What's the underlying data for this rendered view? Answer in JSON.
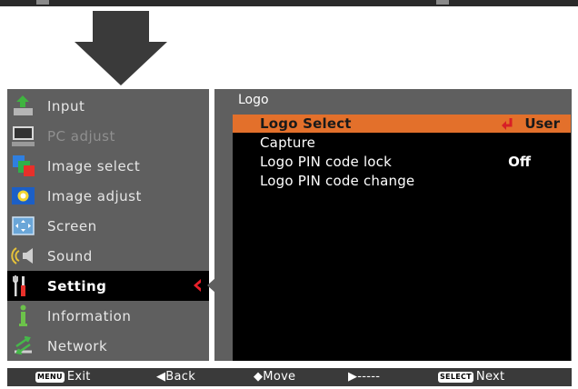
{
  "menu": {
    "items": [
      {
        "label": "Input",
        "icon": "input-icon",
        "state": "normal"
      },
      {
        "label": "PC adjust",
        "icon": "pc-adjust-icon",
        "state": "disabled"
      },
      {
        "label": "Image select",
        "icon": "image-select-icon",
        "state": "normal"
      },
      {
        "label": "Image adjust",
        "icon": "image-adjust-icon",
        "state": "normal"
      },
      {
        "label": "Screen",
        "icon": "screen-icon",
        "state": "normal"
      },
      {
        "label": "Sound",
        "icon": "sound-icon",
        "state": "normal"
      },
      {
        "label": "Setting",
        "icon": "setting-icon",
        "state": "selected"
      },
      {
        "label": "Information",
        "icon": "information-icon",
        "state": "normal"
      },
      {
        "label": "Network",
        "icon": "network-icon",
        "state": "normal"
      }
    ]
  },
  "submenu": {
    "title": "Logo",
    "rows": [
      {
        "label": "Logo Select",
        "value": "User",
        "highlighted": true
      },
      {
        "label": "Capture",
        "value": ""
      },
      {
        "label": "Logo PIN code lock",
        "value": "Off"
      },
      {
        "label": "Logo PIN code change",
        "value": ""
      }
    ]
  },
  "footer": {
    "exit_key": "MENU",
    "exit": "Exit",
    "back": "◀Back",
    "move": "◆Move",
    "next_placeholder": "▶-----",
    "next_key": "SELECT",
    "next": "Next"
  },
  "colors": {
    "highlight": "#e3702b",
    "panel": "#5f5f5f",
    "selected_chevron": "#e8202a",
    "enter_icon": "#e8202a"
  }
}
